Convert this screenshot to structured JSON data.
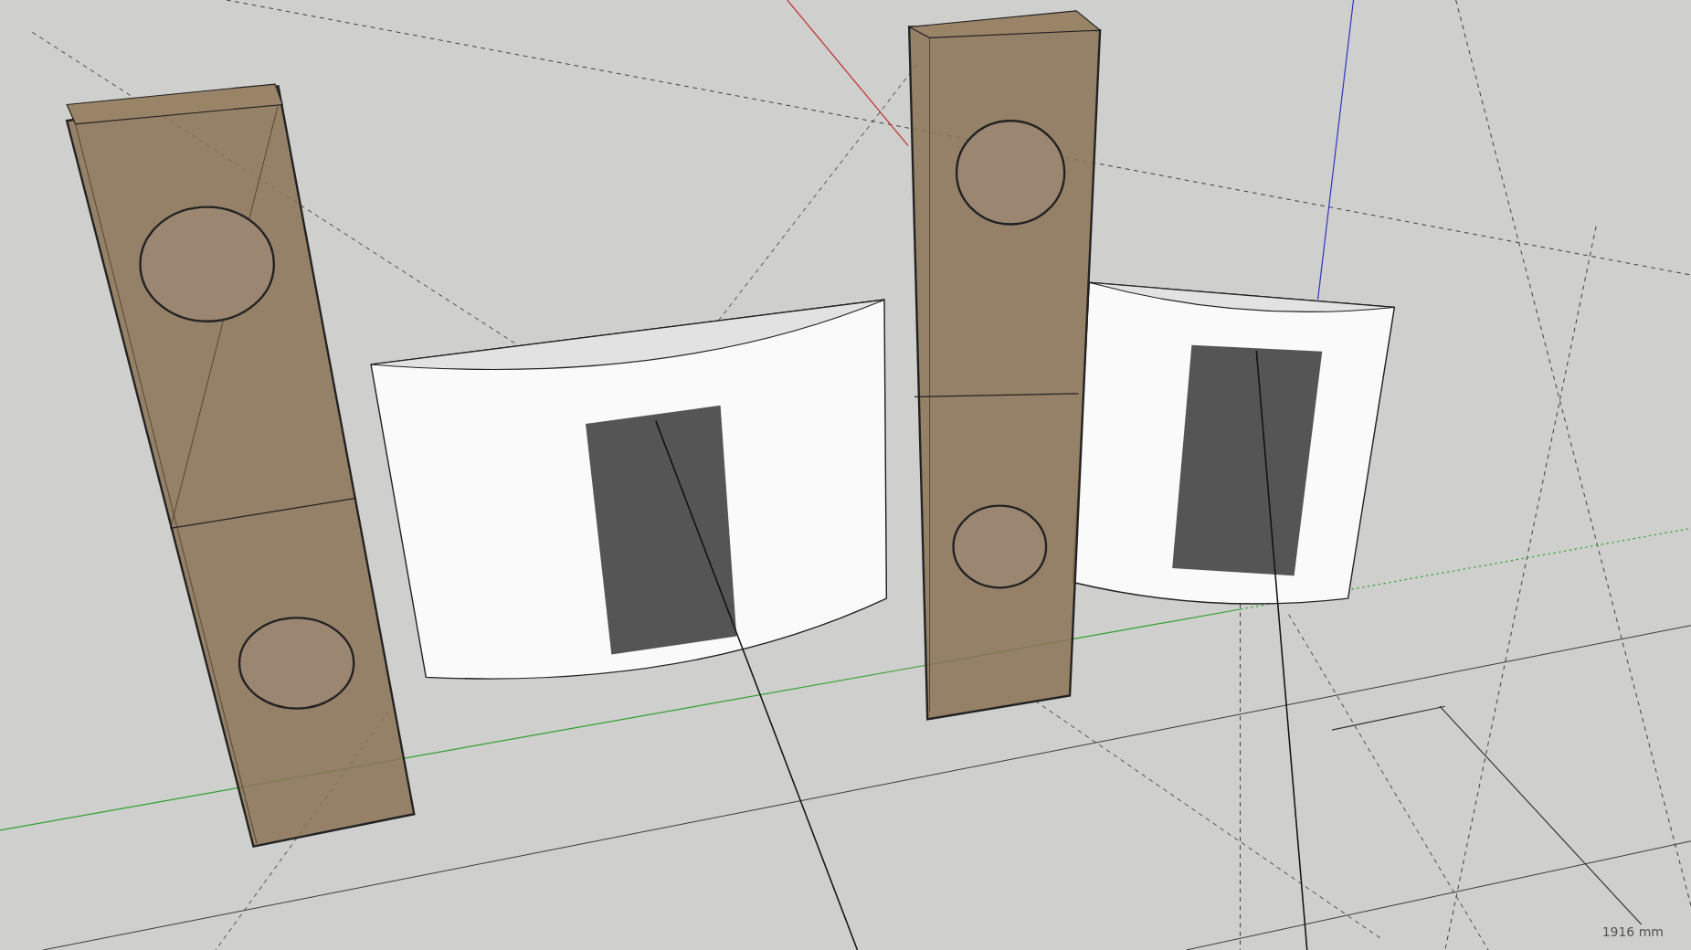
{
  "viewport": {
    "measurement": "1916 mm"
  }
}
